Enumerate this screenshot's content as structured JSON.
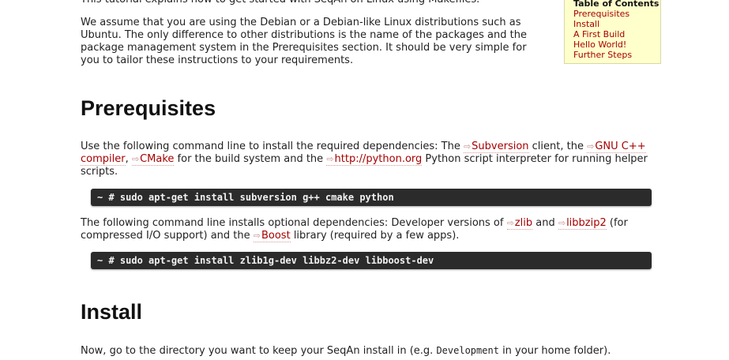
{
  "intro_cut": "This tutorial explains how to get started with SeqAn on Linux using Makefiles.",
  "intro_para": "We assume that you are using the Debian or a Debian-like Linux distributions such as Ubuntu. The only difference to other distributions is the name of the packages and the package management system in the Prerequisites section. It should be very simple for you to tailor these instructions to your requirements.",
  "toc": {
    "title": "Table of Contents",
    "items": [
      "Prerequisites",
      "Install",
      "A First Build",
      "Hello World!",
      "Further Steps"
    ]
  },
  "prereq": {
    "heading": "Prerequisites",
    "p1_a": "Use the following command line to install the required dependencies: The ",
    "link_svn": "Subversion",
    "p1_b": " client, the ",
    "link_gnu": "GNU C++ compiler",
    "p1_c": ", ",
    "link_cmake": "CMake",
    "p1_d": " for the build system and the ",
    "link_python": "http://python.org",
    "p1_e": " Python script interpreter for running helper scripts.",
    "cmd1": "~ # sudo apt-get install subversion g++ cmake python",
    "p2_a": "The following command line installs optional dependencies: Developer versions of ",
    "link_zlib": "zlib",
    "p2_b": " and ",
    "link_libbzip2": "libbzip2",
    "p2_c": " (for compressed I/O support) and the ",
    "link_boost": "Boost",
    "p2_d": " library (required by a few apps).",
    "cmd2": "~ # sudo apt-get install zlib1g-dev libbz2-dev libboost-dev"
  },
  "install": {
    "heading": "Install",
    "p_a": "Now, go to the directory you want to keep your SeqAn install in (e.g. ",
    "code": "Development",
    "p_b": " in your home folder)."
  },
  "ext_link_glyph": "⇨"
}
